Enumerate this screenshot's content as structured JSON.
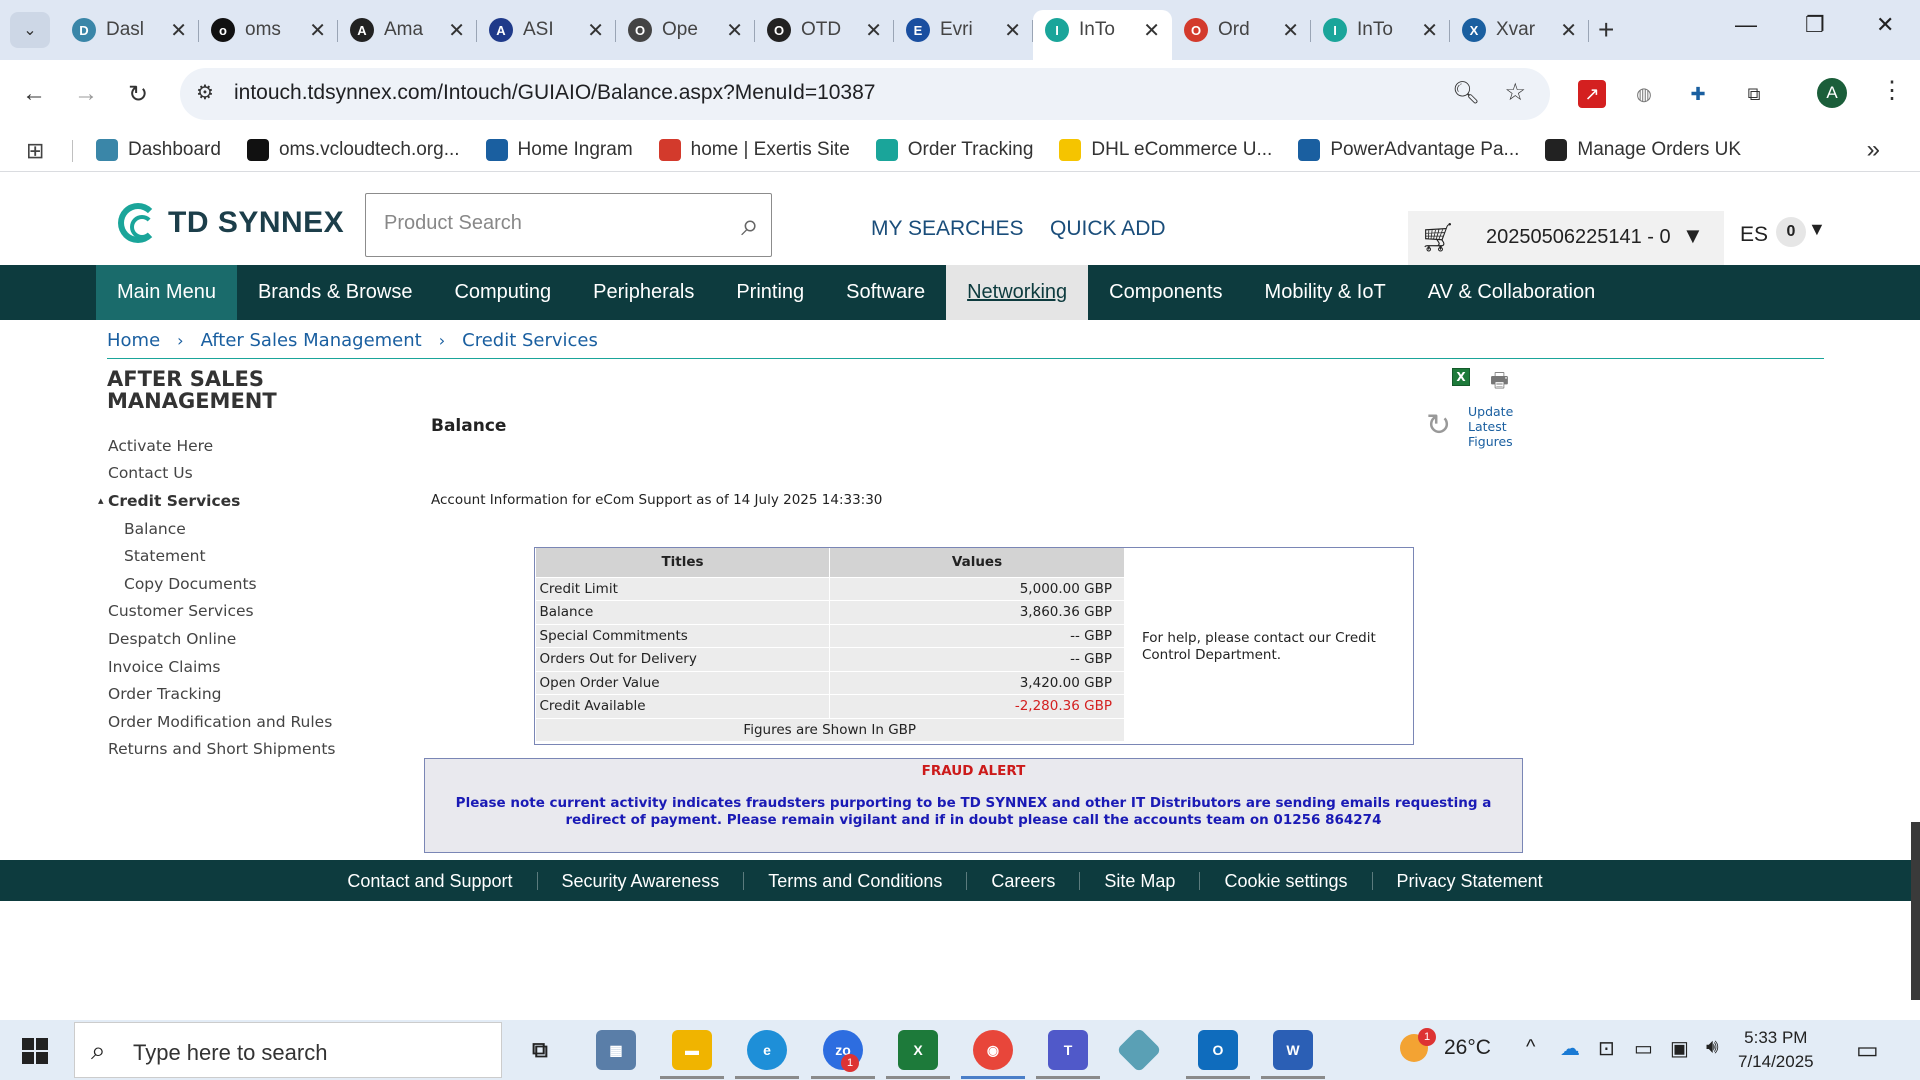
{
  "browser": {
    "tabs": [
      {
        "title": "Dasl",
        "icon": "dashboard-hex-icon",
        "color": "#3a86a8"
      },
      {
        "title": "oms",
        "icon": "oms-triangle-icon",
        "color": "#111111"
      },
      {
        "title": "Ama",
        "icon": "amazon-icon",
        "color": "#222222"
      },
      {
        "title": "ASI",
        "icon": "asi-chevron-icon",
        "color": "#1f3a8a"
      },
      {
        "title": "Ope",
        "icon": "openai-icon",
        "color": "#444444"
      },
      {
        "title": "OTD",
        "icon": "openai-icon",
        "color": "#222222"
      },
      {
        "title": "Evri",
        "icon": "evri-icon",
        "color": "#1a4fa0"
      },
      {
        "title": "InTo",
        "icon": "tdsynnex-icon",
        "color": "#1aa59a",
        "active": true
      },
      {
        "title": "Ord",
        "icon": "exertis-icon",
        "color": "#d33a2c"
      },
      {
        "title": "InTo",
        "icon": "tdsynnex-icon",
        "color": "#1aa59a"
      },
      {
        "title": "Xvar",
        "icon": "xvantage-icon",
        "color": "#1a5fa0"
      }
    ],
    "url": "intouch.tdsynnex.com/Intouch/GUIAIO/Balance.aspx?MenuId=10387",
    "avatar_letter": "A",
    "bookmarks": [
      {
        "label": "Dashboard",
        "color": "#3a86a8"
      },
      {
        "label": "oms.vcloudtech.org...",
        "color": "#111111"
      },
      {
        "label": "Home Ingram",
        "color": "#1a5fa0"
      },
      {
        "label": "home | Exertis Site",
        "color": "#d33a2c"
      },
      {
        "label": "Order Tracking",
        "color": "#1aa59a"
      },
      {
        "label": "DHL eCommerce U...",
        "color": "#f5c400"
      },
      {
        "label": "PowerAdvantage Pa...",
        "color": "#1a5fa0"
      },
      {
        "label": "Manage Orders UK",
        "color": "#222222"
      }
    ]
  },
  "site": {
    "logo_text": "TD SYNNEX",
    "search_placeholder": "Product Search",
    "my_searches": "MY SEARCHES",
    "quick_add": "QUICK ADD",
    "cart_text": "20250506225141 - 0",
    "lang": "ES",
    "count": "0",
    "nav": [
      {
        "label": "Main Menu",
        "type": "menu"
      },
      {
        "label": "Brands & Browse"
      },
      {
        "label": "Computing"
      },
      {
        "label": "Peripherals"
      },
      {
        "label": "Printing"
      },
      {
        "label": "Software"
      },
      {
        "label": "Networking",
        "type": "active"
      },
      {
        "label": "Components"
      },
      {
        "label": "Mobility & IoT"
      },
      {
        "label": "AV & Collaboration"
      }
    ],
    "breadcrumb": [
      "Home",
      "After Sales Management",
      "Credit Services"
    ]
  },
  "sidebar": {
    "title_line1": "AFTER SALES",
    "title_line2": "MANAGEMENT",
    "items": [
      {
        "label": "Activate Here"
      },
      {
        "label": "Contact Us"
      },
      {
        "label": "Credit Services",
        "current": true
      },
      {
        "label": "Balance",
        "sub": true
      },
      {
        "label": "Statement",
        "sub": true
      },
      {
        "label": "Copy Documents",
        "sub": true
      },
      {
        "label": "Customer Services"
      },
      {
        "label": "Despatch Online"
      },
      {
        "label": "Invoice Claims"
      },
      {
        "label": "Order Tracking"
      },
      {
        "label": "Order Modification and Rules"
      },
      {
        "label": "Returns and Short Shipments"
      }
    ]
  },
  "content": {
    "title": "Balance",
    "update_line1": "Update",
    "update_line2": "Latest",
    "update_line3": "Figures",
    "account_info": "Account Information for eCom Support as of 14 July 2025 14:33:30",
    "table": {
      "headers": [
        "Titles",
        "Values"
      ],
      "rows": [
        {
          "title": "Credit Limit",
          "value": "5,000.00 GBP"
        },
        {
          "title": "Balance",
          "value": "3,860.36 GBP"
        },
        {
          "title": "Special Commitments",
          "value": "-- GBP"
        },
        {
          "title": "Orders Out for Delivery",
          "value": "-- GBP"
        },
        {
          "title": "Open Order Value",
          "value": "3,420.00 GBP"
        },
        {
          "title": "Credit Available",
          "value": "-2,280.36 GBP",
          "negative": true
        }
      ],
      "footer": "Figures are Shown In GBP"
    },
    "help_text": "For help, please contact our Credit Control Department.",
    "fraud_title": "FRAUD ALERT",
    "fraud_body": "Please note current activity indicates fraudsters purporting to be TD SYNNEX and other IT Distributors are sending emails requesting a redirect of payment. Please remain vigilant and if in doubt please call the accounts team on 01256 864274"
  },
  "footer": {
    "links": [
      "Contact and Support",
      "Security Awareness",
      "Terms and Conditions",
      "Careers",
      "Site Map",
      "Cookie settings",
      "Privacy Statement"
    ]
  },
  "taskbar": {
    "search_placeholder": "Type here to search",
    "weather": "26°C",
    "time": "5:33 PM",
    "date": "7/14/2025",
    "weather_badge": "1",
    "zoom_badge": "1"
  }
}
